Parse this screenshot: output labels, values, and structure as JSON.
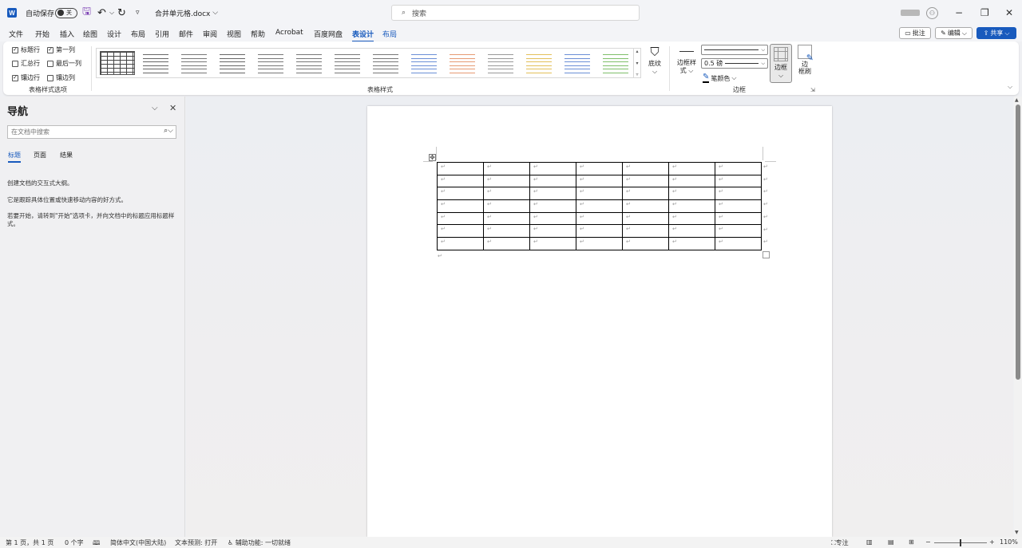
{
  "titlebar": {
    "autosave_label": "自动保存",
    "autosave_state": "关",
    "doc_title": "合并单元格.docx",
    "search_placeholder": "搜索"
  },
  "menu": {
    "tabs": [
      "文件",
      "开始",
      "插入",
      "绘图",
      "设计",
      "布局",
      "引用",
      "邮件",
      "审阅",
      "视图",
      "帮助",
      "Acrobat",
      "百度网盘",
      "表设计",
      "布局"
    ],
    "active_tab": "表设计",
    "comment_label": "批注",
    "edit_label": "编辑",
    "share_label": "共享"
  },
  "ribbon": {
    "options": {
      "header_row": "标题行",
      "first_column": "第一列",
      "total_row": "汇总行",
      "last_column": "最后一列",
      "banded_rows": "镶边行",
      "banded_columns": "镶边列",
      "group_label": "表格样式选项"
    },
    "styles_group_label": "表格样式",
    "shading_label": "底纹",
    "border_styles_label_1": "边框样",
    "border_styles_label_2": "式",
    "pen_weight": "0.5 磅",
    "pen_color_label": "笔颜色",
    "borders_label": "边框",
    "border_painter_label_1": "边",
    "border_painter_label_2": "框刷",
    "borders_group_label": "边框",
    "accent_color": "#185abd"
  },
  "nav": {
    "title": "导航",
    "search_placeholder": "在文档中搜索",
    "tabs": [
      "标题",
      "页面",
      "结果"
    ],
    "text1": "创建文档的交互式大纲。",
    "text2": "它是跟踪具体位置或快速移动内容的好方式。",
    "text3": "若要开始，请转到\"开始\"选项卡，并向文档中的标题应用标题样式。"
  },
  "document": {
    "table_rows": 7,
    "table_cols": 7,
    "cell_mark": "↵"
  },
  "status": {
    "page_info": "第 1 页，共 1 页",
    "word_count": "0 个字",
    "language": "简体中文(中国大陆)",
    "text_prediction": "文本预测: 打开",
    "accessibility": "辅助功能: 一切就绪",
    "focus_label": "专注",
    "zoom": "110%"
  }
}
